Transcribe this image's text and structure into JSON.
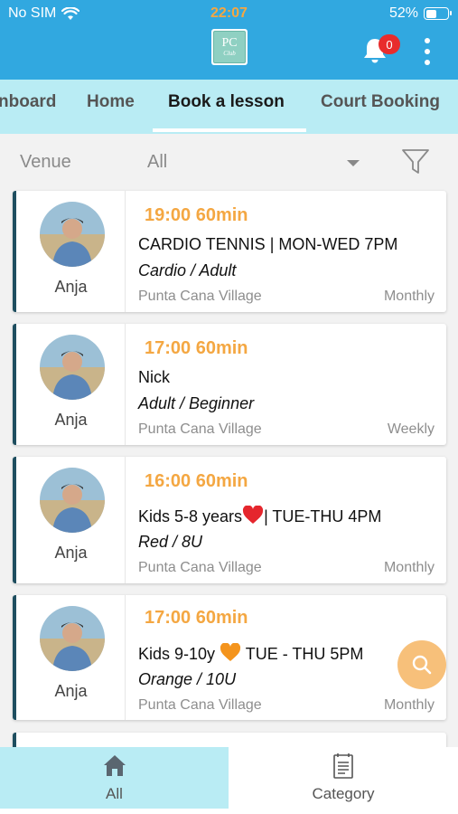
{
  "status": {
    "carrier": "No SIM",
    "time": "22:07",
    "battery": "52%",
    "battery_level": 0.52
  },
  "header": {
    "logo_text": "PC",
    "logo_subtext": "Club",
    "notifications": "0"
  },
  "tabs": [
    {
      "label": "nboard"
    },
    {
      "label": "Home"
    },
    {
      "label": "Book a lesson"
    },
    {
      "label": "Court Booking"
    }
  ],
  "filter": {
    "label": "Venue",
    "value": "All"
  },
  "lessons": [
    {
      "coach": "Anja",
      "time": "19:00 60min",
      "title": "CARDIO TENNIS | MON-WED 7PM",
      "subtitle": "Cardio / Adult",
      "venue": "Punta Cana Village",
      "frequency": "Monthly"
    },
    {
      "coach": "Anja",
      "time": "17:00 60min",
      "title": "Nick",
      "subtitle": "Adult / Beginner",
      "venue": "Punta Cana Village",
      "frequency": "Weekly"
    },
    {
      "coach": "Anja",
      "time": "16:00 60min",
      "title_pre": "Kids 5-8 years",
      "title_post": "| TUE-THU 4PM",
      "subtitle": "Red / 8U",
      "venue": "Punta Cana Village",
      "frequency": "Monthly"
    },
    {
      "coach": "Anja",
      "time": "17:00 60min",
      "title_pre": "Kids 9-10y ",
      "title_post": " TUE - THU 5PM",
      "subtitle": "Orange / 10U",
      "venue": "Punta Cana Village",
      "frequency": "Monthly"
    }
  ],
  "bottom_nav": {
    "all": "All",
    "category": "Category"
  },
  "colors": {
    "header": "#31a8e0",
    "tabs": "#b9ecf4",
    "accent": "#f4a742",
    "stripe": "#1e4e5f",
    "badge": "#e82c2c"
  }
}
